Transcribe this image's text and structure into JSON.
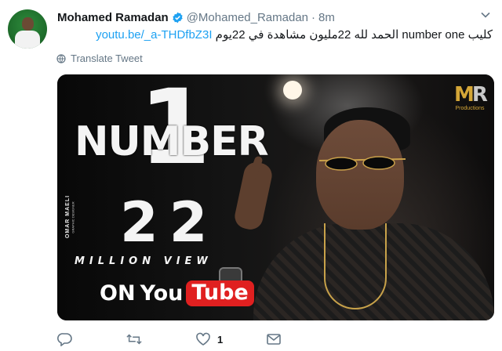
{
  "tweet": {
    "author_name": "Mohamed Ramadan",
    "author_handle": "@Mohamed_Ramadan",
    "separator": "·",
    "time": "8m",
    "text_before_link": "كليب number one الحمد لله 22مليون مشاهدة في 22يوم ",
    "link": "youtu.be/_a-THDfbZ3I",
    "translate_label": "Translate Tweet"
  },
  "media": {
    "big_number": "1",
    "number_word": "NUMBER",
    "views_number": "22",
    "million_view": "MILLION VIEW",
    "on_label": "ON",
    "you_label": "You",
    "tube_label": "Tube",
    "side_brand": "OMAR MAELI",
    "side_brand_sub": "GRAPHIC DESIGNER",
    "logo_m": "M",
    "logo_r": "R",
    "logo_sub": "Productions"
  },
  "actions": {
    "reply_count": "",
    "retweet_count": "",
    "like_count": "1",
    "dm_count": ""
  },
  "icons": [
    "verified-badge-icon",
    "caret-down-icon",
    "globe-icon",
    "reply-icon",
    "retweet-icon",
    "heart-icon",
    "envelope-icon"
  ],
  "colors": {
    "link": "#1da1f2",
    "muted": "#657786",
    "verified": "#1da1f2",
    "youtube_red": "#e02020"
  }
}
